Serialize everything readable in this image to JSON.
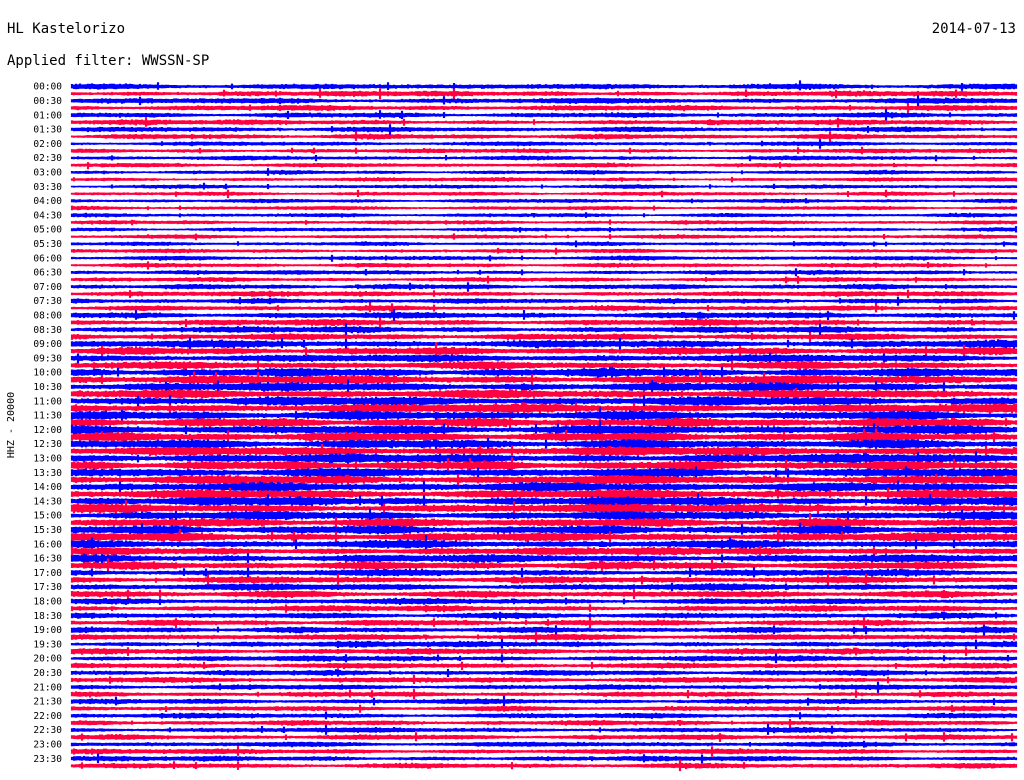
{
  "header": {
    "station": "HL Kastelorizo",
    "date": "2014-07-13",
    "filter": "Applied filter: WWSSN-SP"
  },
  "chart_data": {
    "type": "line",
    "title": "HL Kastelorizo",
    "date": "2014-07-13",
    "filter": "WWSSN-SP",
    "ylabel": "HHZ - 20000",
    "row_interval_minutes": 15,
    "row_count": 96,
    "y_tick_labels": [
      "00:00",
      "00:30",
      "01:00",
      "01:30",
      "02:00",
      "02:30",
      "03:00",
      "03:30",
      "04:00",
      "04:30",
      "05:00",
      "05:30",
      "06:00",
      "06:30",
      "07:00",
      "07:30",
      "08:00",
      "08:30",
      "09:00",
      "09:30",
      "10:00",
      "10:30",
      "11:00",
      "11:30",
      "12:00",
      "12:30",
      "13:00",
      "13:30",
      "14:00",
      "14:30",
      "15:00",
      "15:30",
      "16:00",
      "16:30",
      "17:00",
      "17:30",
      "18:00",
      "18:30",
      "19:00",
      "19:30",
      "20:00",
      "20:30",
      "21:00",
      "21:30",
      "22:00",
      "22:30",
      "23:00",
      "23:30"
    ],
    "series_colors": [
      "#0000ff",
      "#ff0040"
    ],
    "hourly_relative_amplitude": [
      0.75,
      0.7,
      0.6,
      0.55,
      0.55,
      0.55,
      0.6,
      0.7,
      0.85,
      1.0,
      1.15,
      1.2,
      1.2,
      1.2,
      1.2,
      1.15,
      1.05,
      0.9,
      0.8,
      0.8,
      0.75,
      0.7,
      0.7,
      0.7
    ],
    "grid": false
  }
}
